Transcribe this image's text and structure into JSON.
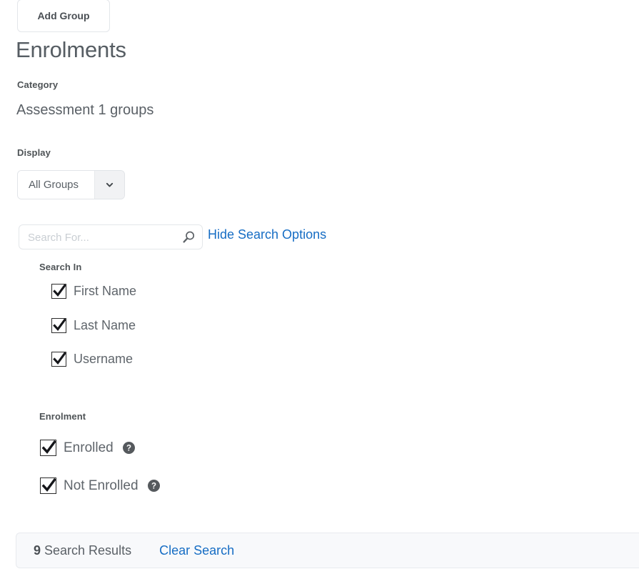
{
  "toolbar": {
    "add_group_label": "Add Group"
  },
  "page": {
    "title": "Enrolments"
  },
  "category": {
    "label": "Category",
    "value": "Assessment 1 groups"
  },
  "display": {
    "label": "Display",
    "selected": "All Groups",
    "options": [
      "All Groups"
    ],
    "chevron_icon": "chevron-down-icon"
  },
  "search": {
    "placeholder": "Search For...",
    "value": "",
    "icon": "search-icon",
    "toggle_options_label": "Hide Search Options"
  },
  "search_in": {
    "label": "Search In",
    "options": [
      {
        "label": "First Name",
        "checked": true
      },
      {
        "label": "Last Name",
        "checked": true
      },
      {
        "label": "Username",
        "checked": true
      }
    ]
  },
  "enrolment": {
    "label": "Enrolment",
    "options": [
      {
        "label": "Enrolled",
        "checked": true,
        "help_icon": "help-icon"
      },
      {
        "label": "Not Enrolled",
        "checked": true,
        "help_icon": "help-icon"
      }
    ]
  },
  "results": {
    "count": "9",
    "count_label": " Search Results",
    "clear_label": "Clear Search"
  },
  "colors": {
    "link": "#166dc4",
    "text": "#5a6066",
    "heading": "#565d63",
    "bar_background": "#f8f9fb"
  }
}
